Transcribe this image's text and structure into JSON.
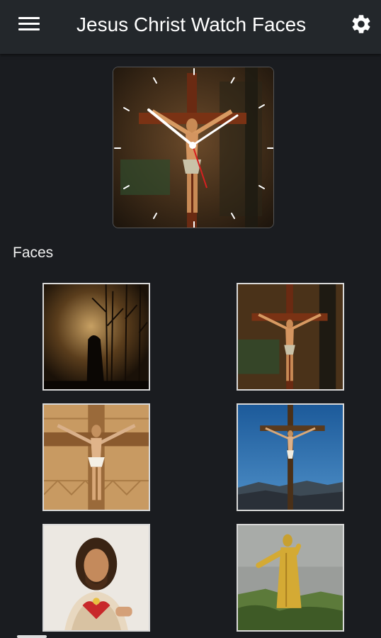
{
  "appbar": {
    "title": "Jesus Christ Watch Faces",
    "menu_icon": "hamburger-menu-icon",
    "settings_icon": "gear-icon"
  },
  "preview": {
    "image": "crucifix-watch-face-preview",
    "hands_color": "#ffffff",
    "second_hand_color": "#d62020"
  },
  "faces_section": {
    "label": "Faces",
    "items": [
      {
        "image": "silhouette-praying-under-trees"
      },
      {
        "image": "crucifix-against-painted-wall"
      },
      {
        "image": "wooden-crucifix-close-up"
      },
      {
        "image": "tall-cross-blue-sky-mountains"
      },
      {
        "image": "sacred-heart-statue"
      },
      {
        "image": "golden-christ-statue-outdoors"
      }
    ]
  },
  "colors": {
    "background": "#1a1c20",
    "appbar": "#23272b",
    "thumb_border": "#d8d8d8"
  }
}
